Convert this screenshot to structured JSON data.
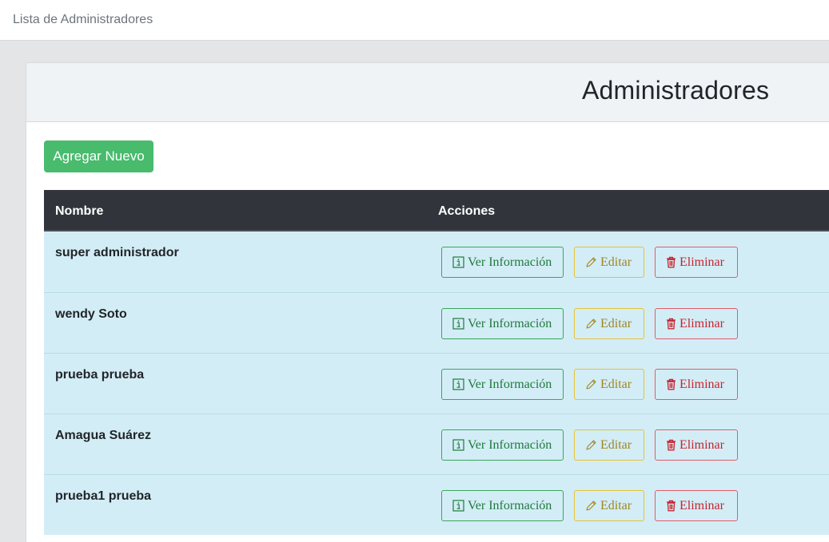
{
  "breadcrumb": "Lista de Administradores",
  "page_title": "Administradores",
  "add_button_label": "Agregar Nuevo",
  "table": {
    "headers": [
      "Nombre",
      "Acciones"
    ],
    "rows": [
      {
        "name": "super administrador"
      },
      {
        "name": "wendy Soto"
      },
      {
        "name": "prueba prueba"
      },
      {
        "name": "Amagua Suárez"
      },
      {
        "name": "prueba1 prueba"
      }
    ]
  },
  "actions": {
    "view_label": "Ver Información",
    "edit_label": "Editar",
    "delete_label": "Eliminar",
    "view_icon": "info-icon",
    "edit_icon": "pencil-icon",
    "delete_icon": "trash-icon"
  },
  "colors": {
    "add_button": "#48bb6d",
    "table_header": "#31353b",
    "row_background": "#d3edf6",
    "view": "#3ba55c",
    "edit": "#e6c237",
    "delete": "#e25c68"
  }
}
